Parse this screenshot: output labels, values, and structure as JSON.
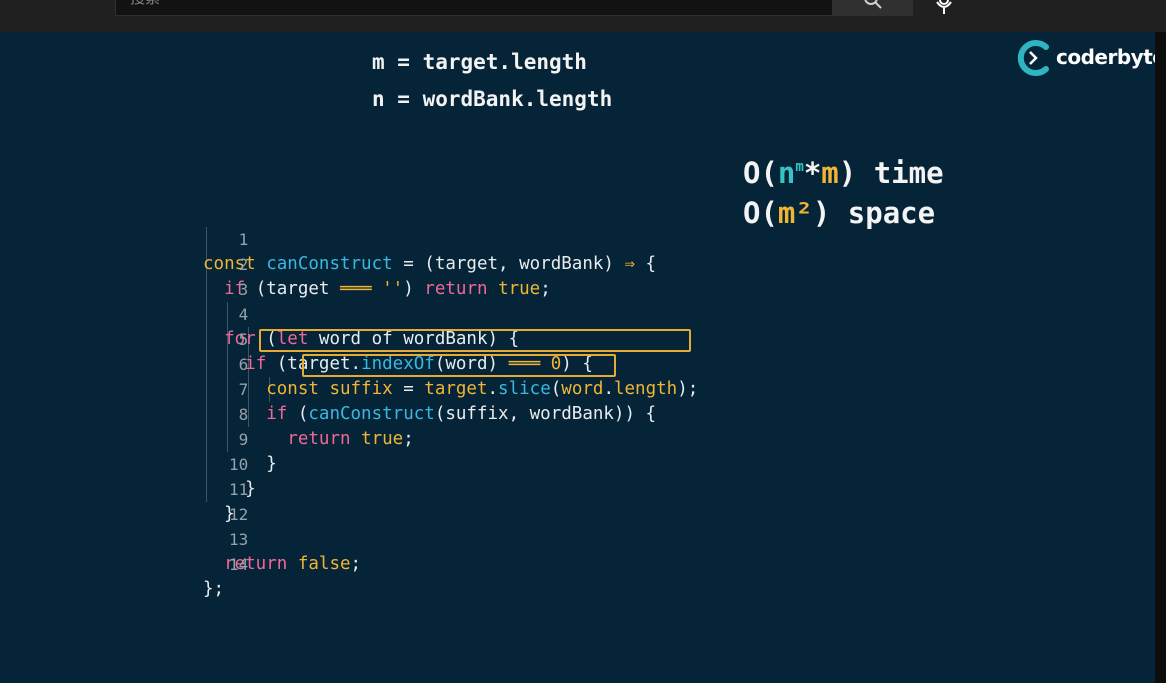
{
  "header": {
    "search_placeholder": "搜索"
  },
  "slide": {
    "var_m": "m = target.length",
    "var_n": "n = wordBank.length",
    "complexity": {
      "time": {
        "o": "O(",
        "n": "n",
        "sup_m": "m",
        "op": "*",
        "m": "m",
        "close": ")",
        "label": " time"
      },
      "space": {
        "o": "O(",
        "m": "m",
        "sup2": "²",
        "close": ")",
        "label": " space"
      }
    },
    "logo_text": "coderbyte"
  },
  "code": {
    "line_numbers": [
      "1",
      "2",
      "3",
      "4",
      "5",
      "6",
      "7",
      "8",
      "9",
      "10",
      "11",
      "12",
      "13",
      "14"
    ]
  },
  "colors": {
    "background": "#052437",
    "keyword": "#f06896",
    "function": "#39b8e0",
    "literal": "#f0b535",
    "highlight_box": "#e6ab37",
    "teal": "#36c4c4"
  }
}
